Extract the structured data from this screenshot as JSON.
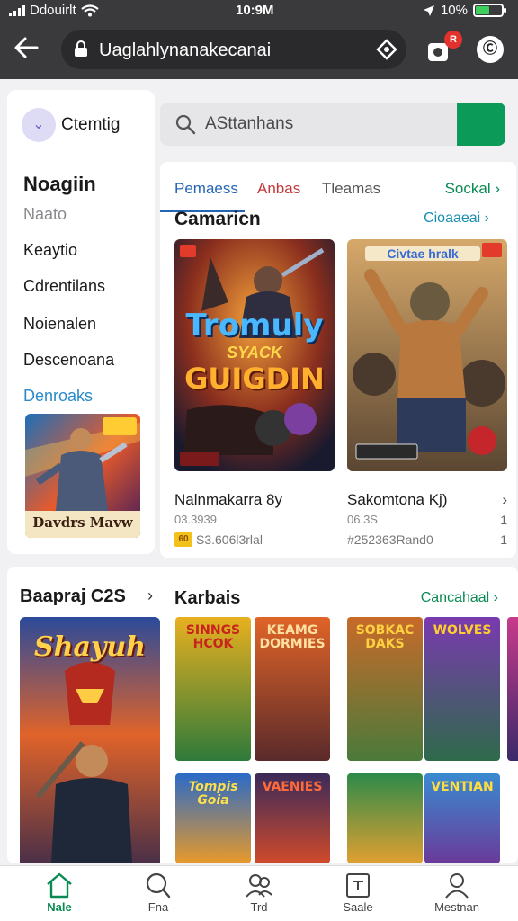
{
  "status": {
    "carrier": "Ddouirlt",
    "time": "10:9M",
    "battery_pct": "10%"
  },
  "browser": {
    "url": "Uaglahlynanakecanai",
    "badge": "R",
    "profile": "Ⓒ"
  },
  "sidebar": {
    "header": "Ctemtig",
    "title": "Noagiin",
    "subtitle": "Naato",
    "items": [
      {
        "label": "Keaytio"
      },
      {
        "label": "Cdrentilans"
      },
      {
        "label": "Noienalen"
      },
      {
        "label": "Descenoana"
      },
      {
        "label": "Denroaks"
      }
    ],
    "poster_title": "Davdrs Mavw"
  },
  "search": {
    "placeholder": "ASttanhans"
  },
  "featured": {
    "tabs": [
      "Pemaess",
      "Anbas",
      "Tleamas"
    ],
    "tabs_more": "Sockal ›",
    "title": "Camaricn",
    "link": "Cioaaeai ›",
    "games": [
      {
        "name": "Nalnmakarra 8y",
        "meta": "03.3939",
        "stat": "S3.606l3rlal",
        "chip": "60",
        "poster_line1": "Tromuly",
        "poster_line2": "SYACK",
        "poster_line3": "GUIGDIN"
      },
      {
        "name": "Sakomtona Kj)",
        "meta": "06.3S",
        "stat": "#252363Rand0",
        "poster_line1": "Civtae hralk"
      }
    ],
    "edge_nums": [
      "1",
      "1"
    ]
  },
  "section2": {
    "title_a": "Baapraj C2S",
    "title_b": "Karbais",
    "link": "Cancahaal ›",
    "big_poster": "Shayuh",
    "tiles": [
      {
        "text": "SINNGS HCOK"
      },
      {
        "text": "KEAMG DORMIES"
      },
      {
        "text": "SOBKAC DAKS"
      },
      {
        "text": "WOLVES"
      },
      {
        "text": "Tompis Goia"
      },
      {
        "text": "VAENIES"
      },
      {
        "text": ""
      },
      {
        "text": "VENTIAN"
      }
    ]
  },
  "bottom_nav": [
    {
      "label": "Nale",
      "icon": "home-icon"
    },
    {
      "label": "Fna",
      "icon": "search-icon"
    },
    {
      "label": "Trd",
      "icon": "group-icon"
    },
    {
      "label": "Saale",
      "icon": "library-icon"
    },
    {
      "label": "Mestnan",
      "icon": "profile-icon"
    }
  ],
  "colors": {
    "accent": "#0c9a58",
    "link": "#2566b3",
    "topbar": "#3a3a3c"
  }
}
